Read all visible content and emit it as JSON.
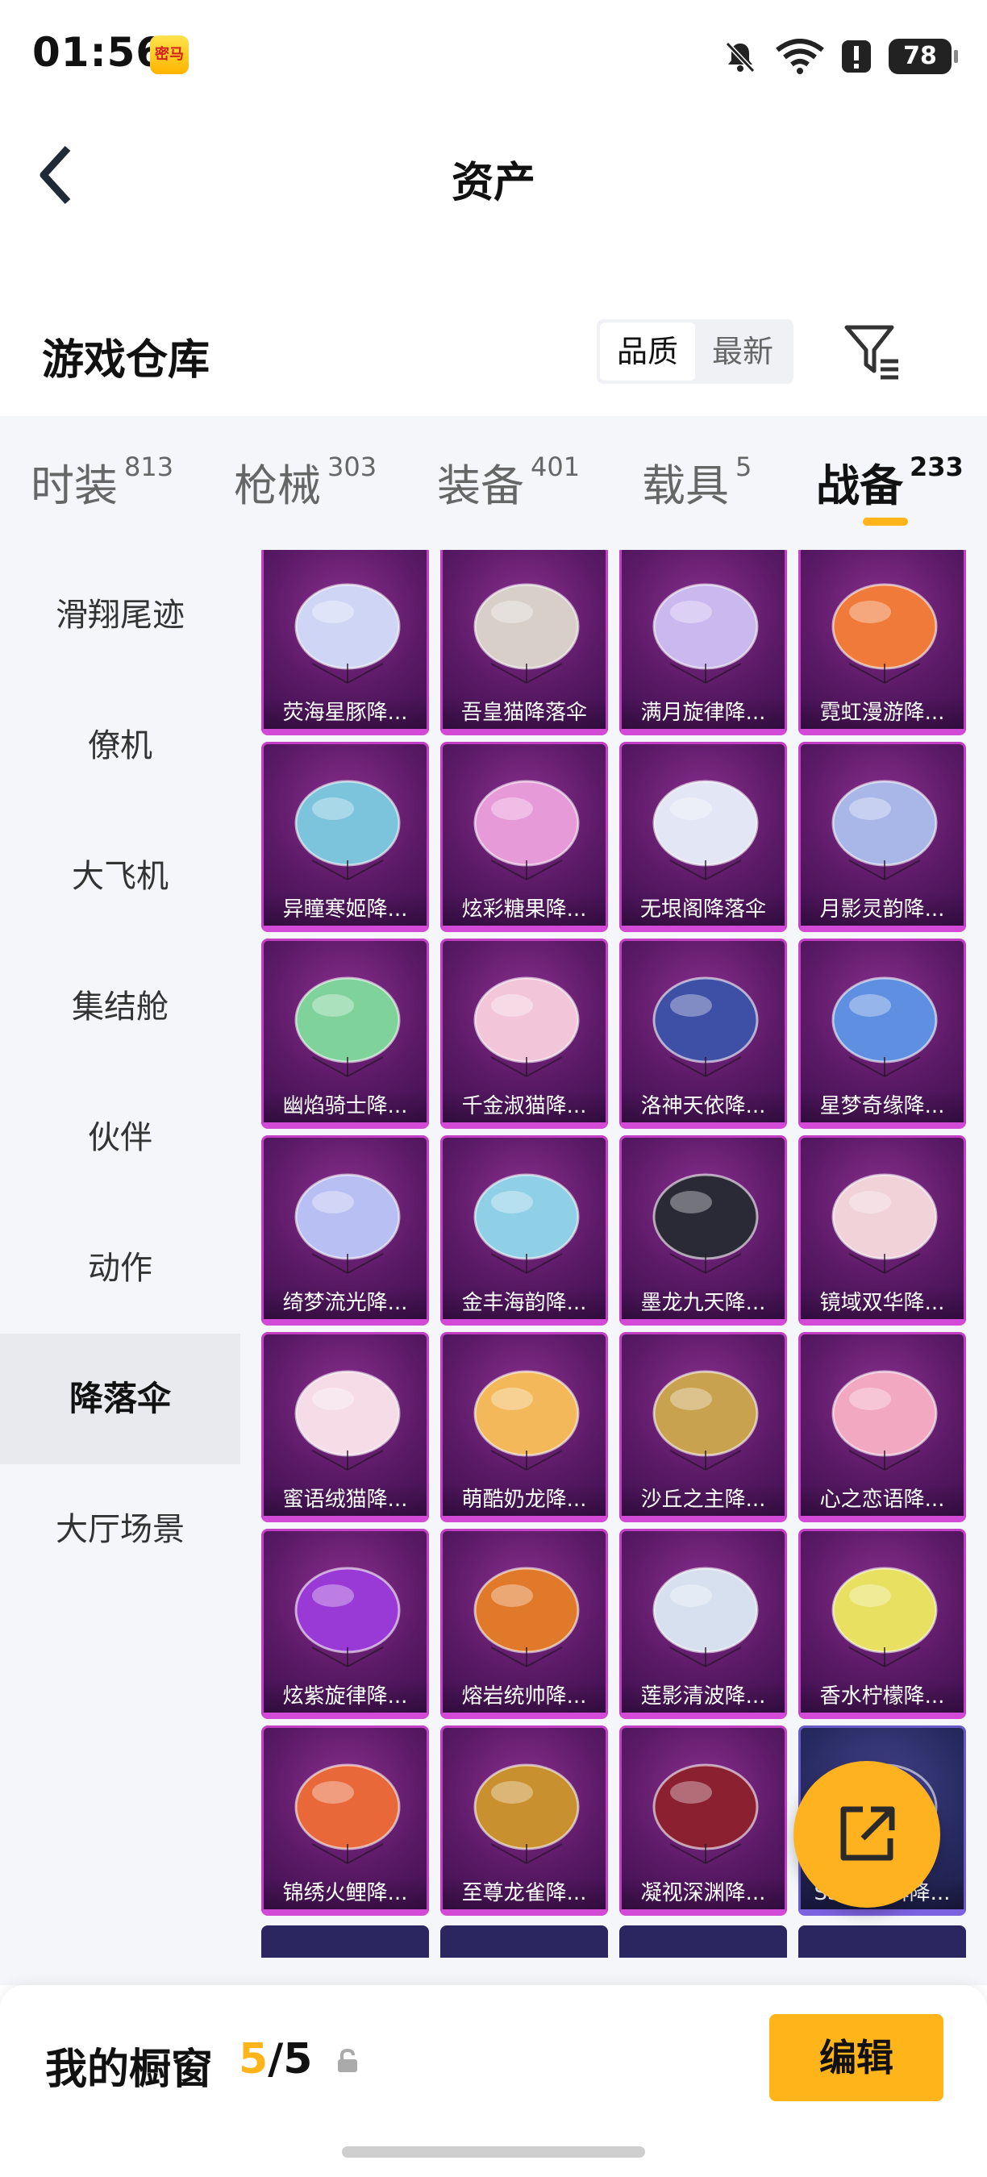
{
  "status": {
    "time": "01:56",
    "app_badge": "密马",
    "battery": "78"
  },
  "header": {
    "title": "资产"
  },
  "section": {
    "title": "游戏仓库",
    "sort_options": [
      "品质",
      "最新"
    ],
    "active_sort": "品质"
  },
  "tabs": [
    {
      "label": "时装",
      "count": "813"
    },
    {
      "label": "枪械",
      "count": "303"
    },
    {
      "label": "装备",
      "count": "401"
    },
    {
      "label": "载具",
      "count": "5"
    },
    {
      "label": "战备",
      "count": "233",
      "active": true
    }
  ],
  "side_nav": [
    {
      "label": "滑翔尾迹"
    },
    {
      "label": "僚机"
    },
    {
      "label": "大飞机"
    },
    {
      "label": "集结舱"
    },
    {
      "label": "伙伴"
    },
    {
      "label": "动作"
    },
    {
      "label": "降落伞",
      "active": true
    },
    {
      "label": "大厅场景"
    }
  ],
  "items": [
    {
      "name": "荧海星豚降...",
      "color": "#cfd6f5"
    },
    {
      "name": "吾皇猫降落伞",
      "color": "#d8d0c8"
    },
    {
      "name": "满月旋律降...",
      "color": "#c9b9ee"
    },
    {
      "name": "霓虹漫游降...",
      "color": "#f07a3a"
    },
    {
      "name": "异瞳寒姬降...",
      "color": "#7cc4dc"
    },
    {
      "name": "炫彩糖果降...",
      "color": "#e69ad8"
    },
    {
      "name": "无垠阁降落伞",
      "color": "#e2e6f5"
    },
    {
      "name": "月影灵韵降...",
      "color": "#a9b7e8"
    },
    {
      "name": "幽焰骑士降...",
      "color": "#7fd29a"
    },
    {
      "name": "千金淑猫降...",
      "color": "#f2c6d8"
    },
    {
      "name": "洛神天依降...",
      "color": "#3e4fa6"
    },
    {
      "name": "星梦奇缘降...",
      "color": "#5e8fe0"
    },
    {
      "name": "绮梦流光降...",
      "color": "#b8bff2"
    },
    {
      "name": "金丰海韵降...",
      "color": "#8fd0e6"
    },
    {
      "name": "墨龙九天降...",
      "color": "#2a2a36"
    },
    {
      "name": "镜域双华降...",
      "color": "#f0d2d8"
    },
    {
      "name": "蜜语绒猫降...",
      "color": "#f5dce6"
    },
    {
      "name": "萌酷奶龙降...",
      "color": "#f2b85a"
    },
    {
      "name": "沙丘之主降...",
      "color": "#c9a250"
    },
    {
      "name": "心之恋语降...",
      "color": "#f2a8c0"
    },
    {
      "name": "炫紫旋律降...",
      "color": "#9a3ad6"
    },
    {
      "name": "熔岩统帅降...",
      "color": "#e07a2a"
    },
    {
      "name": "莲影清波降...",
      "color": "#d6e0ee"
    },
    {
      "name": "香水柠檬降...",
      "color": "#e8e060"
    },
    {
      "name": "锦绣火鲤降...",
      "color": "#e8683a"
    },
    {
      "name": "至尊龙雀降...",
      "color": "#c8902e"
    },
    {
      "name": "凝视深渊降...",
      "color": "#8a2030"
    },
    {
      "name": "SS40王牌降...",
      "color": "#3b3a8a"
    }
  ],
  "bottom": {
    "showcase_label": "我的橱窗",
    "current": "5",
    "total": "5",
    "edit_label": "编辑"
  }
}
